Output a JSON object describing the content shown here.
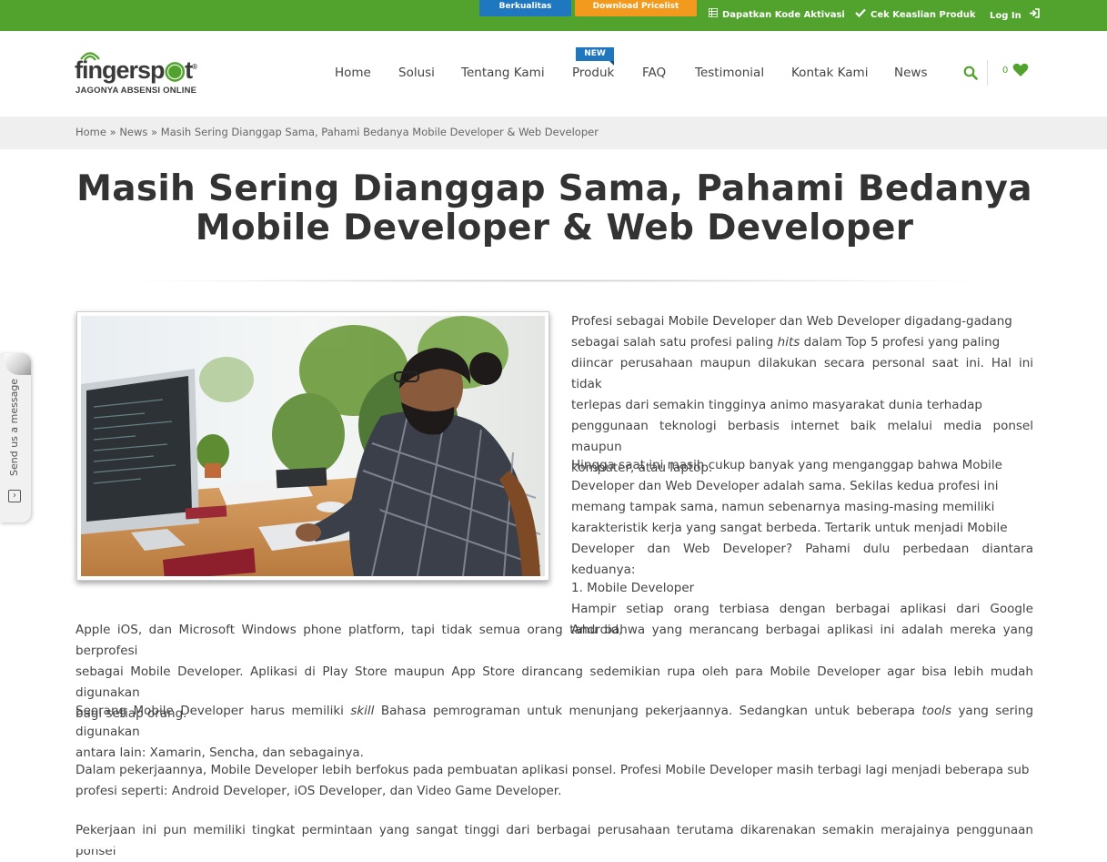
{
  "topbar": {
    "btn_berkualitas": "Berkualitas",
    "btn_pricelist": "Download Pricelist",
    "link_aktivasi": "Dapatkan Kode Aktivasi",
    "link_keaslian": "Cek Keaslian Produk",
    "link_login": "Log In"
  },
  "logo": {
    "word_part1": "fingersp",
    "word_part2": "t",
    "tagline": "JAGONYA ABSENSI ONLINE"
  },
  "nav": {
    "items": [
      "Home",
      "Solusi",
      "Tentang Kami",
      "Produk",
      "FAQ",
      "Testimonial",
      "Kontak Kami",
      "News"
    ],
    "new_badge": "NEW",
    "cart_count": "0"
  },
  "breadcrumb": {
    "home": "Home",
    "sep1": " » ",
    "news": "News",
    "sep2": " » ",
    "current": "Masih Sering Dianggap Sama, Pahami Bedanya Mobile Developer & Web Developer"
  },
  "article": {
    "title_line1": "Masih Sering Dianggap Sama, Pahami Bedanya",
    "title_line2": "Mobile Developer & Web Developer",
    "image_alt": "Developer bekerja di depan komputer",
    "p1": [
      "Profesi sebagai Mobile Developer dan Web Developer digadang-gadang",
      "sebagai salah satu profesi paling",
      "hits",
      "dalam Top 5 profesi yang paling",
      "diincar perusahaan maupun dilakukan secara personal saat ini. Hal ini tidak",
      "terlepas dari semakin tingginya animo masyarakat dunia terhadap",
      "penggunaan teknologi berbasis internet baik melalui media ponsel maupun",
      "komputer, atau laptop."
    ],
    "p2": [
      "Hingga saat ini masih cukup banyak yang menganggap bahwa Mobile",
      "Developer dan Web Developer adalah sama. Sekilas kedua profesi ini",
      "memang tampak sama, namun sebenarnya masing-masing memiliki",
      "karakteristik kerja yang sangat berbeda. Tertarik untuk menjadi Mobile",
      "Developer dan Web Developer? Pahami dulu perbedaan diantara keduanya:"
    ],
    "h1": "1. Mobile Developer",
    "p3_side": "Hampir setiap orang terbiasa dengan berbagai aplikasi dari Google Android,",
    "p3_full": [
      "Apple iOS, dan Microsoft Windows phone platform, tapi tidak semua orang tahu bahwa yang merancang berbagai aplikasi ini adalah mereka yang berprofesi",
      "sebagai Mobile Developer. Aplikasi di Play Store maupun App Store dirancang sedemikian rupa oleh para Mobile Developer agar bisa lebih mudah digunakan",
      "bagi setiap orang."
    ],
    "p4": [
      "Seorang Mobile Developer harus memiliki",
      "skill",
      "Bahasa pemrograman untuk menunjang pekerjaannya. Sedangkan untuk beberapa",
      "tools",
      "yang sering digunakan",
      "antara lain: Xamarin, Sencha, dan sebagainya."
    ],
    "p5": [
      "Dalam pekerjaannya, Mobile Developer lebih berfokus pada pembuatan aplikasi ponsel. Profesi Mobile Developer masih terbagi lagi menjadi beberapa sub",
      "profesi seperti: Android Developer, iOS Developer, dan Video Game Developer."
    ],
    "p6": [
      "Pekerjaan ini pun memiliki tingkat permintaan yang sangat tinggi dari berbagai perusahaan terutama dikarenakan semakin merajainya penggunaan ponsel"
    ]
  },
  "widget": {
    "send_message": "Send us a message"
  },
  "colors": {
    "brand_green": "#52a22e",
    "blue": "#1f77bf",
    "orange": "#f29a1e"
  }
}
